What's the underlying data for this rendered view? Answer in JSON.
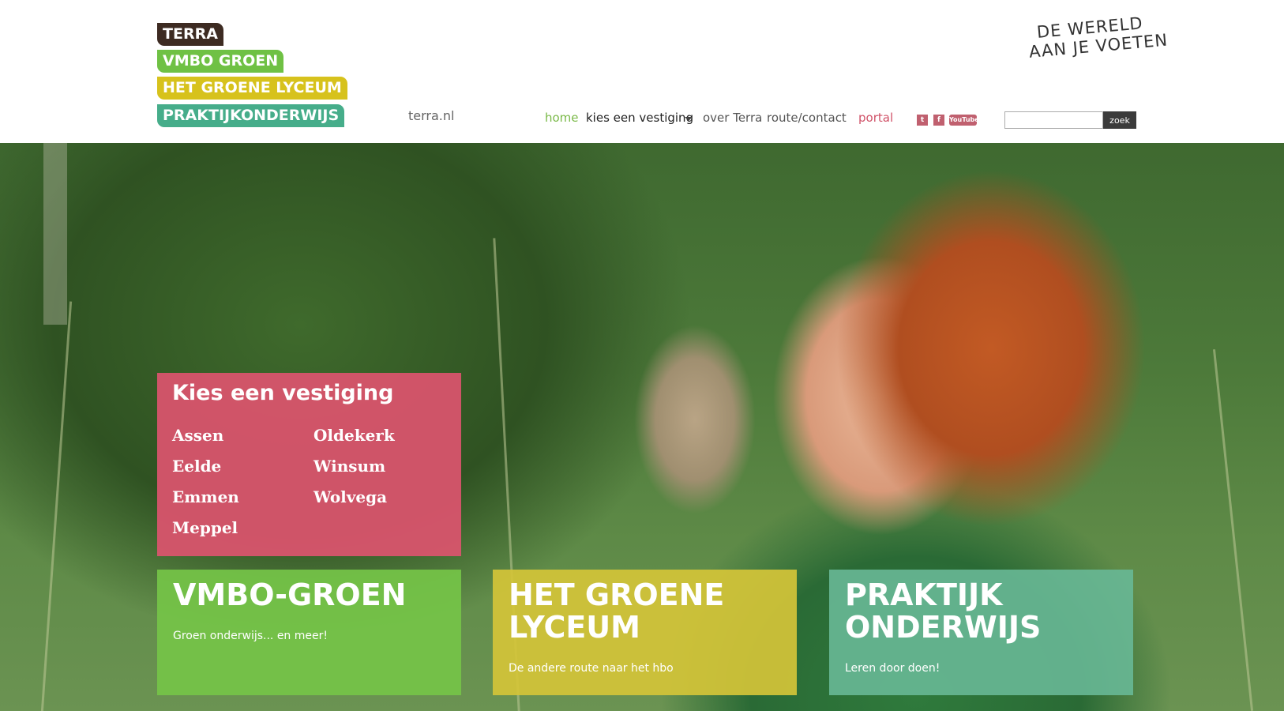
{
  "header": {
    "logo_lines": [
      "TERRA",
      "VMBO GROEN",
      "HET GROENE LYCEUM",
      "PRAKTIJKONDERWIJS"
    ],
    "site_link": "terra.nl",
    "tagline_lines": [
      "DE WERELD",
      "AAN JE VOETEN"
    ]
  },
  "nav": {
    "home": "home",
    "kies": "kies een vestiging",
    "over": "over Terra",
    "route": "route/contact",
    "portal": "portal"
  },
  "social": {
    "twitter": "t",
    "facebook": "f",
    "youtube": "YouTube"
  },
  "search": {
    "value": "",
    "button": "zoek"
  },
  "locations": {
    "title": "Kies een vestiging",
    "col1": [
      "Assen",
      "Eelde",
      "Emmen",
      "Meppel"
    ],
    "col2": [
      "Oldekerk",
      "Winsum",
      "Wolvega"
    ]
  },
  "cards": [
    {
      "title_lines": [
        "VMBO-GROEN"
      ],
      "subtitle": "Groen onderwijs... en meer!"
    },
    {
      "title_lines": [
        "HET GROENE",
        "LYCEUM"
      ],
      "subtitle": "De andere route naar het hbo"
    },
    {
      "title_lines": [
        "PRAKTIJK",
        "ONDERWIJS"
      ],
      "subtitle": "Leren door doen!"
    }
  ],
  "colors": {
    "logo_dark": "#3d2b22",
    "vmbo_green": "#6fc144",
    "lyceum_yellow": "#d7c21c",
    "praktijk_teal": "#46ad8a",
    "panel_pink": "#db546e",
    "nav_active": "#7ab948",
    "portal_link": "#d05268"
  }
}
